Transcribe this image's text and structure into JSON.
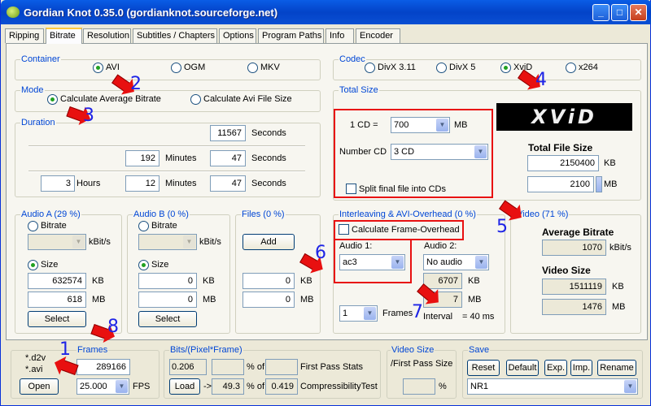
{
  "window": {
    "title": "Gordian Knot 0.35.0 (gordianknot.sourceforge.net)",
    "minimize": "_",
    "maximize": "□",
    "close": "✕"
  },
  "tabs": [
    "Ripping",
    "Bitrate",
    "Resolution",
    "Subtitles / Chapters",
    "Options",
    "Program Paths",
    "Info",
    "Encoder"
  ],
  "container": {
    "label": "Container",
    "options": [
      "AVI",
      "OGM",
      "MKV"
    ],
    "selected": "AVI"
  },
  "codec": {
    "label": "Codec",
    "options": [
      "DivX 3.11",
      "DivX 5",
      "XviD",
      "x264"
    ],
    "selected": "XviD"
  },
  "mode": {
    "label": "Mode",
    "options": [
      "Calculate Average Bitrate",
      "Calculate Avi File Size"
    ],
    "selected": "Calculate Average Bitrate"
  },
  "duration": {
    "label": "Duration",
    "seconds_total": "11567",
    "seconds_label": "Seconds",
    "minutes": "192",
    "minutes_label": "Minutes",
    "sec2": "47",
    "hours": "3",
    "hours_label": "Hours",
    "minutes2": "12",
    "sec3": "47"
  },
  "total_size": {
    "label": "Total Size",
    "cd_label": "1 CD =",
    "cd_value": "700",
    "mb": "MB",
    "number_cd_label": "Number CD",
    "number_cd_value": "3 CD",
    "split_label": "Split final file into CDs",
    "logo": "XViD",
    "total_file_size_label": "Total File Size",
    "kb_value": "2150400",
    "kb": "KB",
    "mb_value": "2100"
  },
  "audio_a": {
    "label": "Audio A (29 %)",
    "bitrate_label": "Bitrate",
    "kbits": "kBit/s",
    "size_label": "Size",
    "kb_value": "632574",
    "kb": "KB",
    "mb_value": "618",
    "mb": "MB",
    "select": "Select"
  },
  "audio_b": {
    "label": "Audio B (0 %)",
    "bitrate_label": "Bitrate",
    "kbits": "kBit/s",
    "size_label": "Size",
    "kb_value": "0",
    "kb": "KB",
    "mb_value": "0",
    "mb": "MB",
    "select": "Select"
  },
  "files": {
    "label": "Files (0 %)",
    "add": "Add",
    "kb_value": "0",
    "kb": "KB",
    "mb_value": "0",
    "mb": "MB"
  },
  "interleaving": {
    "label": "Interleaving & AVI-Overhead (0 %)",
    "calc_label": "Calculate  Frame-Overhead",
    "audio1_label": "Audio 1:",
    "audio1_value": "ac3",
    "audio2_label": "Audio 2:",
    "audio2_value": "No audio",
    "kb_value": "6707",
    "kb": "KB",
    "mb_value": "7",
    "mb": "MB",
    "frames_value": "1",
    "frames_label": "Frames",
    "interval_label": "Interval",
    "interval_value": "= 40 ms"
  },
  "video": {
    "label": "Video (71 %)",
    "avg_bitrate_label": "Average Bitrate",
    "avg_bitrate_value": "1070",
    "kbits": "kBit/s",
    "video_size_label": "Video Size",
    "kb_value": "1511119",
    "kb": "KB",
    "mb_value": "1476",
    "mb": "MB"
  },
  "bottom": {
    "file_types": [
      "*.d2v",
      "*.avi"
    ],
    "open": "Open",
    "frames_label": "Frames",
    "frames_value": "289166",
    "fps_value": "25.000",
    "fps_label": "FPS",
    "bpf_label": "Bits/(Pixel*Frame)",
    "bpf_value": "0.206",
    "percent_of": "% of",
    "first_pass_stats": "First Pass Stats",
    "load": "Load",
    "arrow": "->",
    "pct_value": "49.3",
    "comp_value": "0.419",
    "compressibility": "CompressibilityTest",
    "video_size_label": "Video Size",
    "first_pass_size_label": "/First Pass Size",
    "percent": "%",
    "save_label": "Save",
    "reset": "Reset",
    "default": "Default",
    "exp": "Exp.",
    "imp": "Imp.",
    "rename": "Rename",
    "preset": "NR1"
  },
  "annotations": [
    "1",
    "2",
    "3",
    "4",
    "5",
    "6",
    "7",
    "8"
  ],
  "colors": {
    "annotation_red": "#e81010",
    "annotation_blue": "#1e24e6",
    "group_label": "#0046d5"
  }
}
